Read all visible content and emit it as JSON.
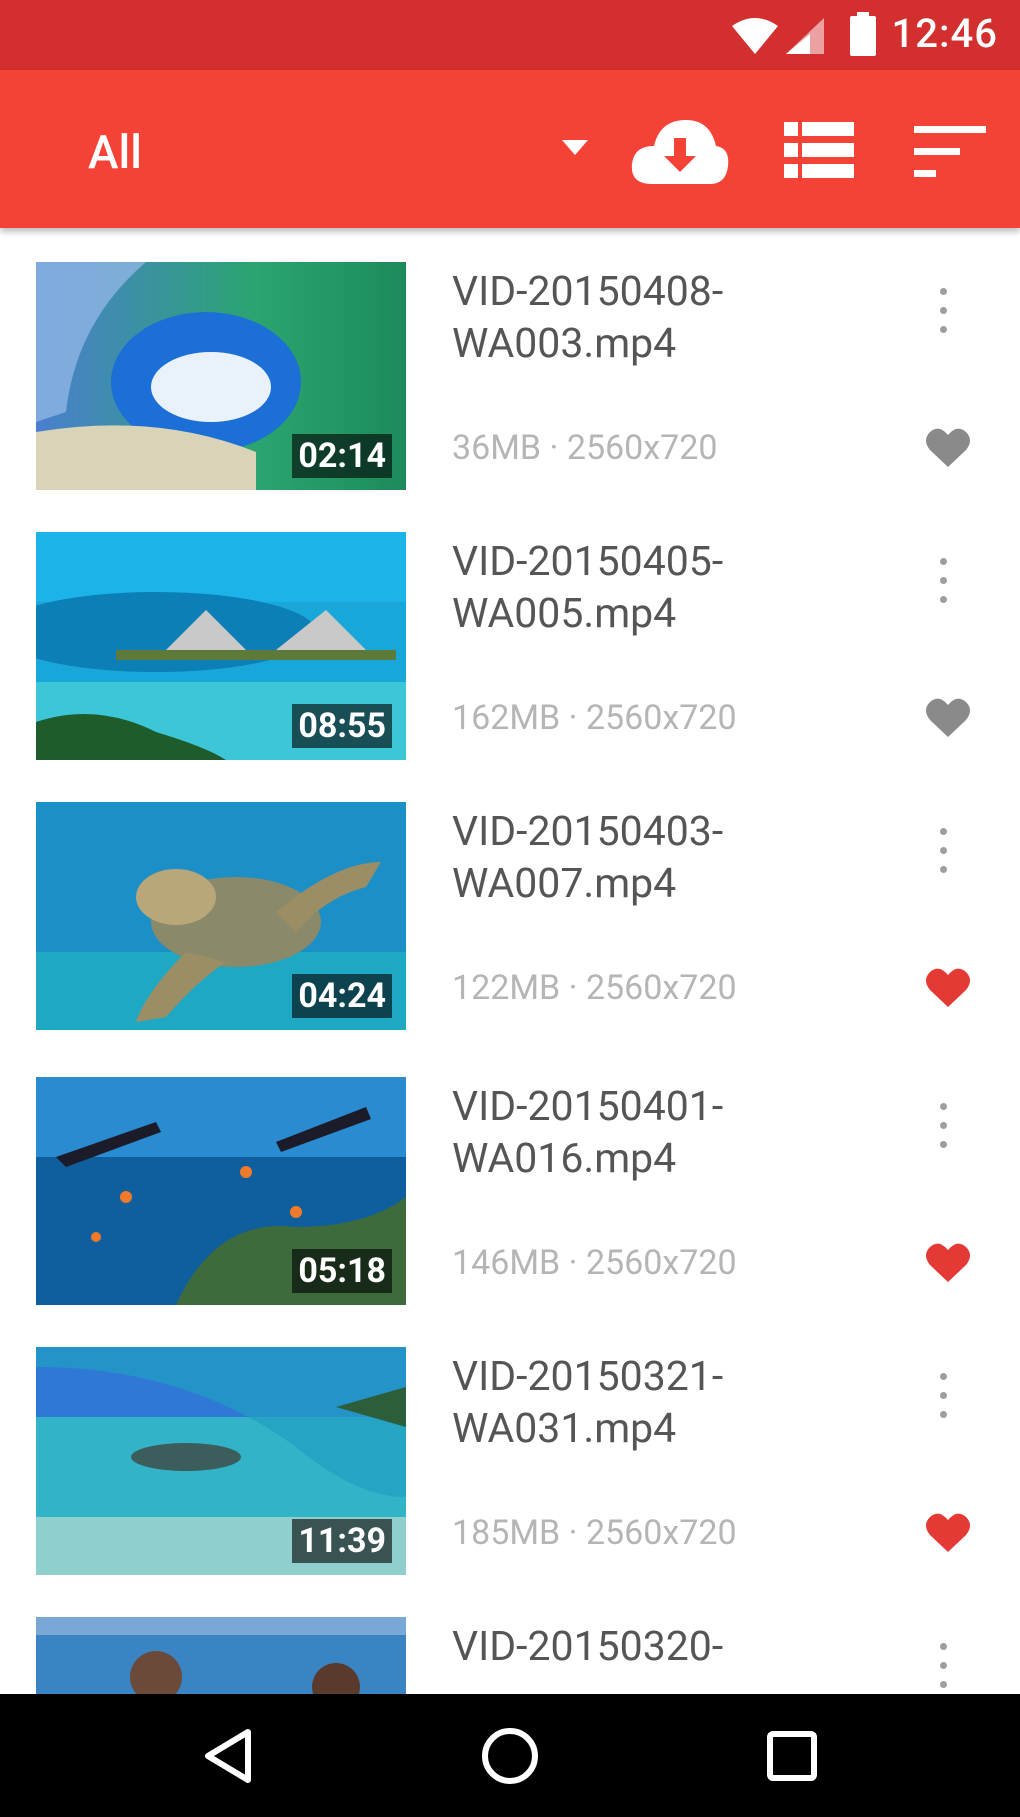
{
  "status_bar": {
    "time": "12:46"
  },
  "toolbar": {
    "filter_label": "All",
    "icons": [
      "dropdown-icon",
      "cloud-download-icon",
      "list-view-icon",
      "sort-icon"
    ]
  },
  "videos": [
    {
      "name_line1": "VID-20150408-",
      "name_line2": "WA003.mp4",
      "duration": "02:14",
      "meta": "36MB · 2560x720",
      "favorite": false
    },
    {
      "name_line1": "VID-20150405-",
      "name_line2": "WA005.mp4",
      "duration": "08:55",
      "meta": "162MB · 2560x720",
      "favorite": false
    },
    {
      "name_line1": "VID-20150403-",
      "name_line2": "WA007.mp4",
      "duration": "04:24",
      "meta": "122MB · 2560x720",
      "favorite": true
    },
    {
      "name_line1": "VID-20150401-",
      "name_line2": "WA016.mp4",
      "duration": "05:18",
      "meta": "146MB · 2560x720",
      "favorite": true
    },
    {
      "name_line1": "VID-20150321-",
      "name_line2": "WA031.mp4",
      "duration": "11:39",
      "meta": "185MB · 2560x720",
      "favorite": true
    },
    {
      "name_line1": "VID-20150320-",
      "name_line2": "",
      "duration": "",
      "meta": "",
      "favorite": false
    }
  ],
  "colors": {
    "status_bar": "#d32f2f",
    "app_bar": "#f44336",
    "favorite": "#e53935",
    "not_favorite": "#8a8a8a"
  },
  "nav_bar": {
    "icons": [
      "back-icon",
      "home-icon",
      "recents-icon"
    ]
  }
}
